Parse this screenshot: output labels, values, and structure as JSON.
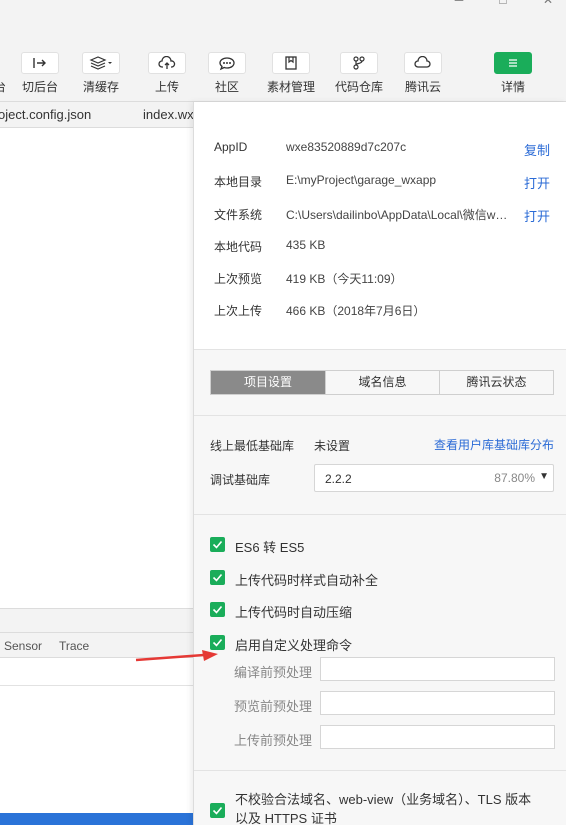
{
  "toolbar": {
    "items": [
      {
        "label": "台",
        "icon": "partial-icon"
      },
      {
        "label": "切后台",
        "icon": "switch-background-icon"
      },
      {
        "label": "清缓存",
        "icon": "layers-icon"
      },
      {
        "label": "上传",
        "icon": "cloud-upload-icon"
      },
      {
        "label": "社区",
        "icon": "chat-icon"
      },
      {
        "label": "素材管理",
        "icon": "bookmark-icon"
      },
      {
        "label": "代码仓库",
        "icon": "branch-icon"
      },
      {
        "label": "腾讯云",
        "icon": "cloud-icon"
      },
      {
        "label": "详情",
        "icon": "menu-icon"
      }
    ],
    "accent": "#1aad5a"
  },
  "editor": {
    "tabs": [
      "oject.config.json",
      "index.wx"
    ],
    "bottom_tabs": [
      "Sensor",
      "Trace"
    ]
  },
  "details": {
    "info": [
      {
        "label": "AppID",
        "value": "wxe83520889d7c207c",
        "action": "复制"
      },
      {
        "label": "本地目录",
        "value": "E:\\myProject\\garage_wxapp",
        "action": "打开"
      },
      {
        "label": "文件系统",
        "value": "C:\\Users\\dailinbo\\AppData\\Local\\微信w…",
        "action": "打开"
      },
      {
        "label": "本地代码",
        "value": "435 KB",
        "action": ""
      },
      {
        "label": "上次预览",
        "value": "419 KB（今天11:09）",
        "action": ""
      },
      {
        "label": "上次上传",
        "value": "466 KB（2018年7月6日）",
        "action": ""
      }
    ],
    "tabs": [
      "项目设置",
      "域名信息",
      "腾讯云状态"
    ],
    "min_lib_label": "线上最低基础库",
    "min_lib_value": "未设置",
    "min_lib_link": "查看用户库基础库分布",
    "debug_lib_label": "调试基础库",
    "debug_lib_value": "2.2.2",
    "debug_lib_percent": "87.80%",
    "checks": [
      {
        "label": "ES6 转 ES5",
        "checked": true
      },
      {
        "label": "上传代码时样式自动补全",
        "checked": true
      },
      {
        "label": "上传代码时自动压缩",
        "checked": true
      },
      {
        "label": "启用自定义处理命令",
        "checked": true
      }
    ],
    "commands": [
      {
        "label": "编译前预处理",
        "value": ""
      },
      {
        "label": "预览前预处理",
        "value": ""
      },
      {
        "label": "上传前预处理",
        "value": ""
      }
    ],
    "domain_check": "不校验合法域名、web-view（业务域名）、TLS 版本以及 HTTPS 证书",
    "link_color": "#2b6bd6"
  }
}
